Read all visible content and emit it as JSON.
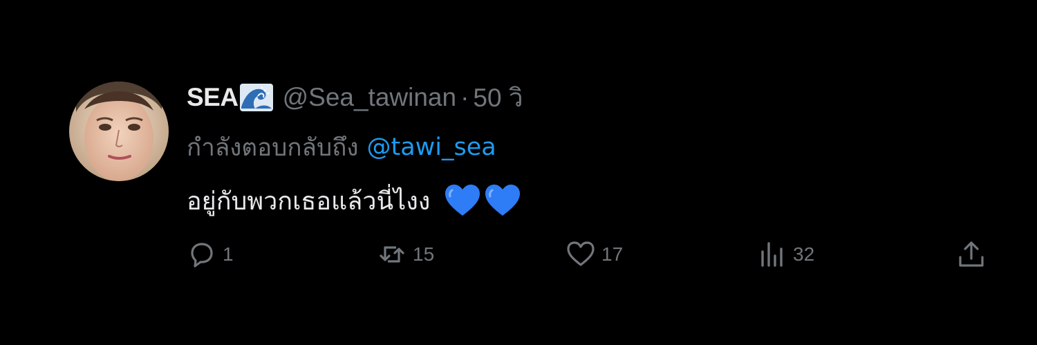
{
  "tweet": {
    "display_name": "SEA",
    "name_emoji_icon": "water-wave-emoji-icon",
    "handle": "@Sea_tawinan",
    "separator": "·",
    "time": "50 วิ",
    "reply_prefix": "กำลังตอบกลับถึง",
    "reply_mention": "@tawi_sea",
    "text": "อยู่กับพวกเธอแล้วนี่ไงง",
    "text_emoji": [
      "blue-heart-emoji-icon",
      "blue-heart-emoji-icon"
    ]
  },
  "actions": {
    "reply": {
      "icon": "reply-bubble-icon",
      "count": "1"
    },
    "retweet": {
      "icon": "retweet-icon",
      "count": "15"
    },
    "like": {
      "icon": "heart-outline-icon",
      "count": "17"
    },
    "views": {
      "icon": "analytics-bars-icon",
      "count": "32"
    },
    "share": {
      "icon": "share-upload-icon"
    }
  },
  "colors": {
    "background": "#000000",
    "primary_text": "#e7e9ea",
    "secondary_text": "#71767b",
    "link": "#1d9bf0",
    "heart_emoji": "#2e7cf6"
  }
}
